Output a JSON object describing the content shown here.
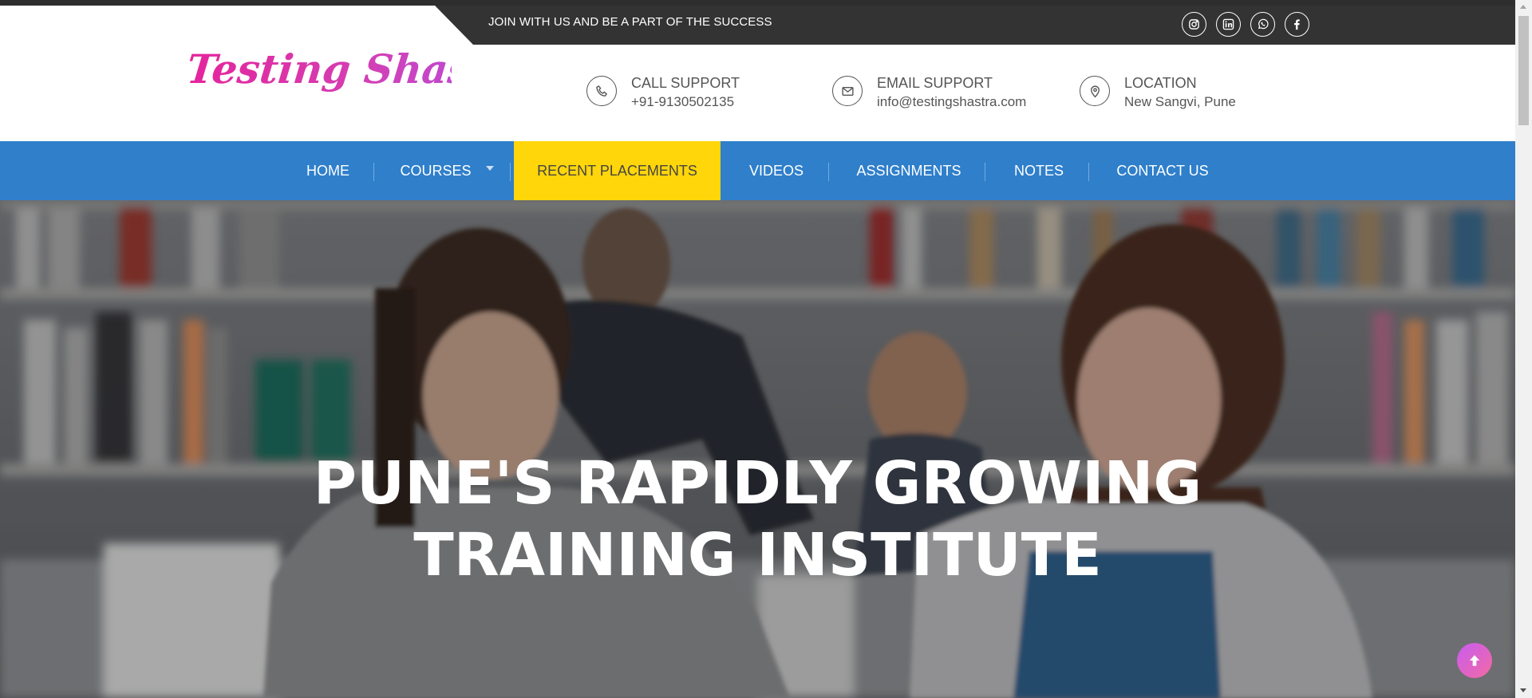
{
  "topbar": {
    "tagline": "JOIN WITH US AND BE A PART OF THE SUCCESS",
    "social_icons": [
      "instagram-icon",
      "linkedin-icon",
      "whatsapp-icon",
      "facebook-icon"
    ]
  },
  "brand": {
    "logo_text": "Testing Shastra",
    "logo_colors": [
      "#e5249c",
      "#b04fe6"
    ]
  },
  "contacts": [
    {
      "icon": "phone-icon",
      "title": "CALL SUPPORT",
      "value": "+91-9130502135"
    },
    {
      "icon": "envelope-icon",
      "title": "EMAIL SUPPORT",
      "value": "info@testingshastra.com"
    },
    {
      "icon": "map-pin-icon",
      "title": "LOCATION",
      "value": "New Sangvi, Pune"
    }
  ],
  "nav": {
    "items": [
      {
        "label": "HOME"
      },
      {
        "label": "COURSES",
        "has_dropdown": true
      },
      {
        "label": "RECENT PLACEMENTS",
        "active": true
      },
      {
        "label": "VIDEOS"
      },
      {
        "label": "ASSIGNMENTS"
      },
      {
        "label": "NOTES"
      },
      {
        "label": "CONTACT US"
      }
    ],
    "bg_color": "#2f7fcb",
    "active_color": "#ffd60a"
  },
  "hero": {
    "title_line1": "PUNE'S RAPIDLY GROWING",
    "title_line2": "TRAINING INSTITUTE"
  },
  "scroll_top_icon": "arrow-up-icon"
}
